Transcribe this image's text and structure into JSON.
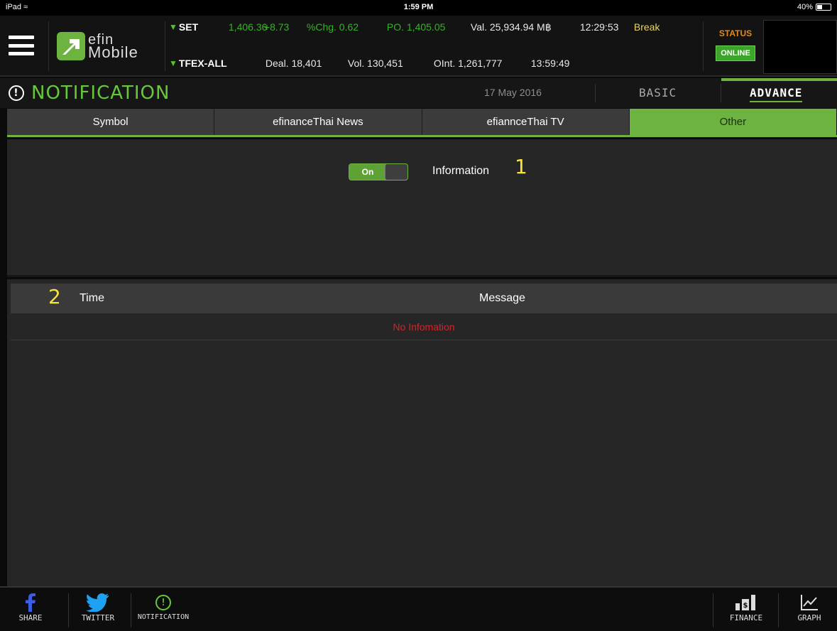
{
  "status_bar": {
    "device": "iPad",
    "time": "1:59 PM",
    "battery": "40%",
    "battery_level": 0.4
  },
  "header": {
    "logo_line1": "efin",
    "logo_line2": "Mobile",
    "set": {
      "name": "SET",
      "index": "1,406.36",
      "change": "+8.73",
      "pct_change": "%Chg. 0.62",
      "po": "PO. 1,405.05",
      "value": "Val. 25,934.94 M฿",
      "time": "12:29:53",
      "state": "Break"
    },
    "tfex": {
      "name": "TFEX-ALL",
      "deal": "Deal. 18,401",
      "volume": "Vol. 130,451",
      "oi": "OInt. 1,261,777",
      "time": "13:59:49"
    },
    "status_label": "STATUS",
    "status_value": "ONLINE"
  },
  "titlebar": {
    "title": "NOTIFICATION",
    "date": "17 May 2016",
    "mode_basic": "BASIC",
    "mode_advance": "ADVANCE"
  },
  "tabs": [
    {
      "label": "Symbol",
      "active": false
    },
    {
      "label": "efinanceThai News",
      "active": false
    },
    {
      "label": "efiannceThai TV",
      "active": false
    },
    {
      "label": "Other",
      "active": true
    }
  ],
  "settings": {
    "toggle_state": "On",
    "toggle_label": "Information",
    "marker1": "1"
  },
  "table": {
    "marker2": "2",
    "col_time": "Time",
    "col_message": "Message",
    "empty_text": "No Infomation"
  },
  "bottom_bar": {
    "share": "SHARE",
    "twitter": "TWITTER",
    "notification": "NOTIFICATION",
    "finance": "FINANCE",
    "graph": "GRAPH"
  },
  "colors": {
    "accent_green": "#6db33f",
    "status_orange": "#e48a1b",
    "error_red": "#d1252a",
    "marker_yellow": "#f7e43b"
  }
}
